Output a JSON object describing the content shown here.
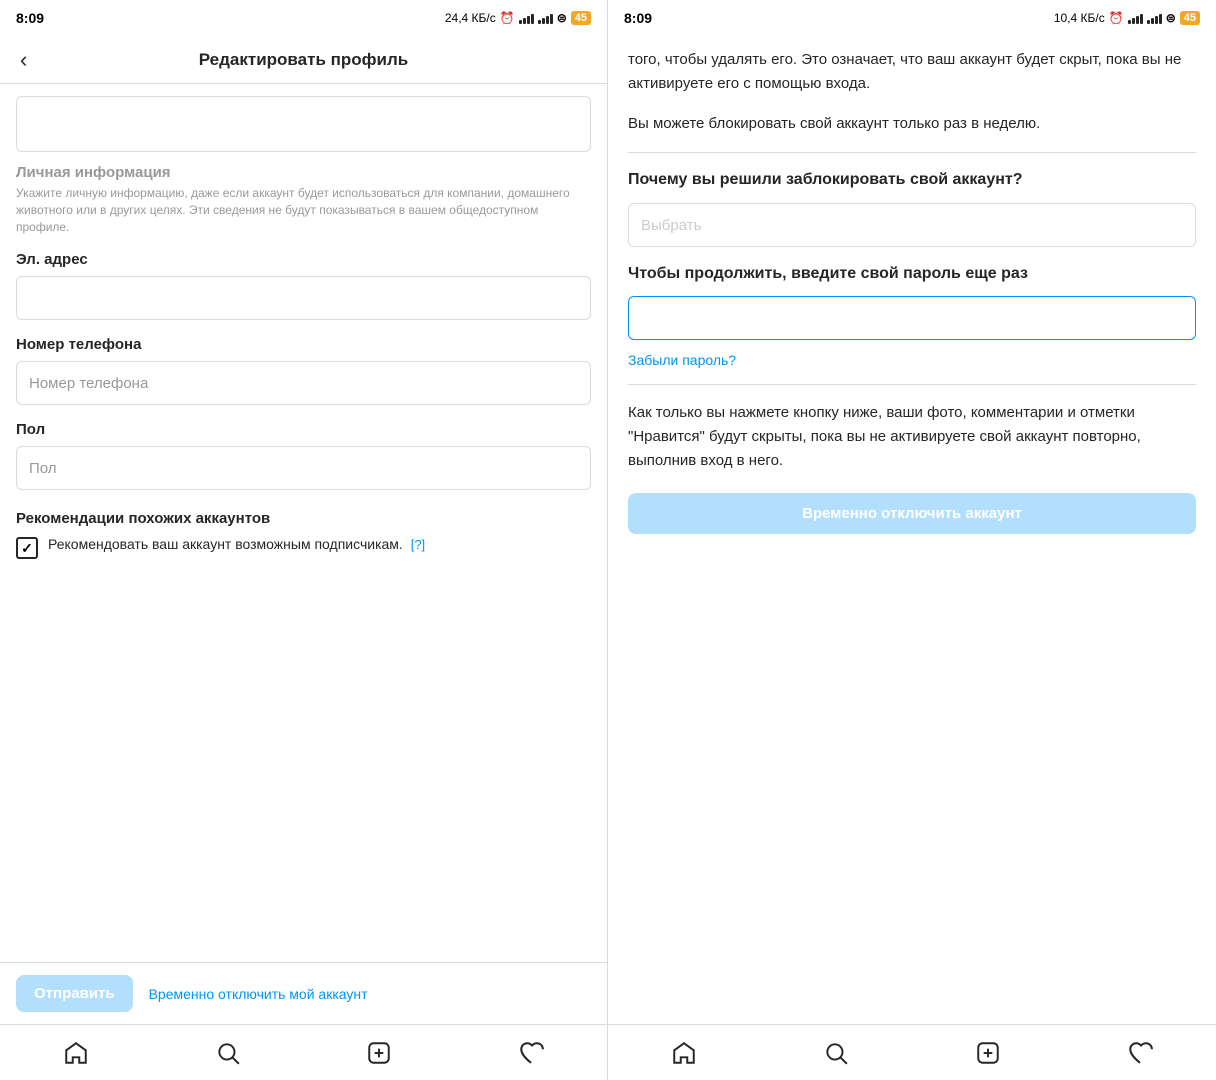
{
  "left": {
    "statusBar": {
      "time": "8:09",
      "speed": "24,4 КБ/с",
      "battery": "45"
    },
    "header": {
      "backLabel": "‹",
      "title": "Редактировать профиль"
    },
    "sections": {
      "personalInfo": {
        "title": "Личная информация",
        "desc": "Укажите личную информацию, даже если аккаунт будет использоваться для компании, домашнего животного или в других целях. Эти сведения не будут показываться в вашем общедоступном профиле."
      },
      "email": {
        "label": "Эл. адрес",
        "placeholder": ""
      },
      "phone": {
        "label": "Номер телефона",
        "placeholder": "Номер телефона"
      },
      "gender": {
        "label": "Пол",
        "placeholder": "Пол"
      },
      "recommendations": {
        "title": "Рекомендации похожих аккаунтов",
        "checkboxText": "Рекомендовать ваш аккаунт возможным подписчикам.",
        "helpLabel": "[?]"
      }
    },
    "footer": {
      "submitLabel": "Отправить",
      "disableLabel": "Временно отключить мой аккаунт"
    }
  },
  "right": {
    "statusBar": {
      "time": "8:09",
      "speed": "10,4 КБ/с",
      "battery": "45"
    },
    "content": {
      "introText1": "того, чтобы удалять его. Это означает, что ваш аккаунт будет скрыт, пока вы не активируете его с помощью входа.",
      "introText2": "Вы можете блокировать свой аккаунт только раз в неделю.",
      "questionTitle": "Почему вы решили заблокировать свой аккаунт?",
      "selectPlaceholder": "Выбрать",
      "passwordTitle": "Чтобы продолжить, введите свой пароль еще раз",
      "forgotPassword": "Забыли пароль?",
      "bottomNote": "Как только вы нажмете кнопку ниже, ваши фото, комментарии и отметки \"Нравится\" будут скрыты, пока вы не активируете свой аккаунт повторно, выполнив вход в него.",
      "disableButtonLabel": "Временно отключить аккаунт"
    }
  }
}
